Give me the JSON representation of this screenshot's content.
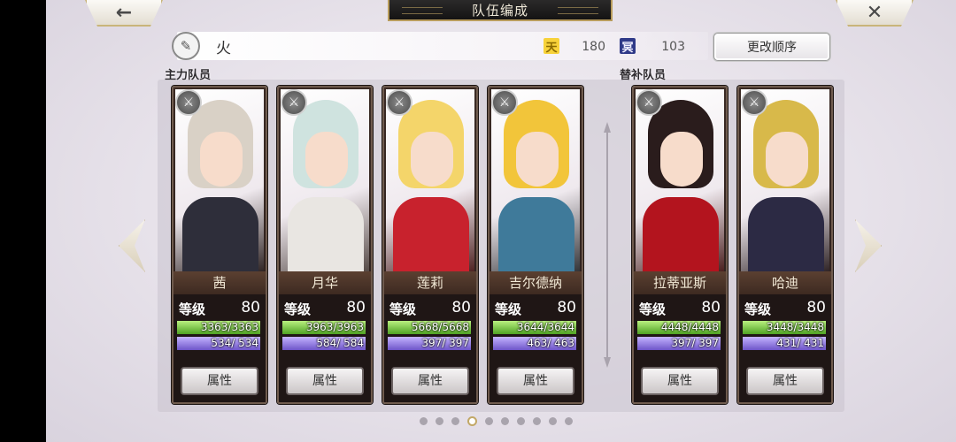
{
  "header": {
    "title": "队伍编成",
    "back_symbol": "←",
    "close_symbol": "✕"
  },
  "team": {
    "name": "火",
    "edit_icon": "pen-icon",
    "heaven_icon_text": "天",
    "heaven_value": "180",
    "hell_icon_text": "冥",
    "hell_value": "103",
    "order_button": "更改顺序"
  },
  "labels": {
    "main": "主力队员",
    "sub": "替补队员"
  },
  "level_label": "等级",
  "attr_label": "属性",
  "weapon_symbol": "⚔",
  "members": [
    {
      "name": "茜",
      "level": "80",
      "hp": "3363/3363",
      "mp": "534/ 534",
      "hair": "#d9d1c6",
      "body": "#2e2e3a"
    },
    {
      "name": "月华",
      "level": "80",
      "hp": "3963/3963",
      "mp": "584/ 584",
      "hair": "#cfe3df",
      "body": "#e9e6e2"
    },
    {
      "name": "莲莉",
      "level": "80",
      "hp": "5668/5668",
      "mp": "397/ 397",
      "hair": "#f4d56a",
      "body": "#c8222d"
    },
    {
      "name": "吉尔德纳",
      "level": "80",
      "hp": "3644/3644",
      "mp": "463/ 463",
      "hair": "#f2c53a",
      "body": "#3f7a9a"
    },
    {
      "name": "拉蒂亚斯",
      "level": "80",
      "hp": "4448/4448",
      "mp": "397/ 397",
      "hair": "#2a1c1c",
      "body": "#b3141e"
    },
    {
      "name": "哈迪",
      "level": "80",
      "hp": "3448/3448",
      "mp": "431/ 431",
      "hair": "#d8b94a",
      "body": "#2c2a44"
    }
  ],
  "pager": {
    "count": 10,
    "active": 3
  }
}
